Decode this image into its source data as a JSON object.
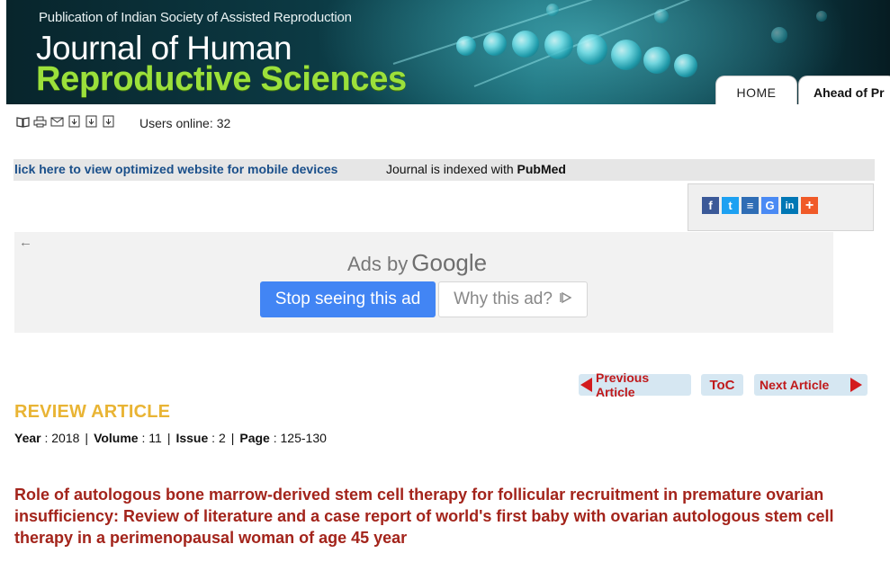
{
  "header": {
    "publication": "Publication of Indian Society of Assisted Reproduction",
    "title_line1": "Journal of Human",
    "title_line2": "Reproductive Sciences",
    "tabs": [
      {
        "label": "HOME"
      },
      {
        "label": "Ahead of Pr"
      }
    ]
  },
  "toolbar": {
    "icons": [
      "book-icon",
      "print-icon",
      "email-icon",
      "article-download-icon",
      "article-reader-icon",
      "article-cite-icon"
    ],
    "users_online_label": "Users online:",
    "users_online_count": "32"
  },
  "mobile_bar": {
    "link_text": "lick here to view optimized website for mobile devices",
    "indexed_prefix": "Journal is indexed with",
    "indexed_name": "PubMed"
  },
  "share": {
    "icons": [
      {
        "name": "facebook-icon",
        "glyph": "f",
        "color": "#3b5998"
      },
      {
        "name": "twitter-icon",
        "glyph": "t",
        "color": "#1da1f2"
      },
      {
        "name": "list-icon",
        "glyph": "≡",
        "color": "#2f6db5"
      },
      {
        "name": "google-icon",
        "glyph": "G",
        "color": "#4a8af4"
      },
      {
        "name": "linkedin-icon",
        "glyph": "in",
        "color": "#0077b5"
      },
      {
        "name": "plus-icon",
        "glyph": "+",
        "color": "#f05a28"
      }
    ]
  },
  "ad": {
    "ads_by": "Ads by",
    "google": "Google",
    "stop_label": "Stop seeing this ad",
    "why_label": "Why this ad?"
  },
  "article_nav": {
    "prev_label": "Previous Article",
    "toc_label": "ToC",
    "next_label": "Next Article"
  },
  "article": {
    "type": "REVIEW ARTICLE",
    "meta": {
      "year_label": "Year",
      "year": "2018",
      "volume_label": "Volume",
      "volume": "11",
      "issue_label": "Issue",
      "issue": "2",
      "page_label": "Page",
      "page": "125-130"
    },
    "title": "Role of autologous bone marrow-derived stem cell therapy for follicular recruitment in premature ovarian insufficiency: Review of literature and a case report of world's first baby with ovarian autologous stem cell therapy in a perimenopausal woman of age 45 year"
  }
}
